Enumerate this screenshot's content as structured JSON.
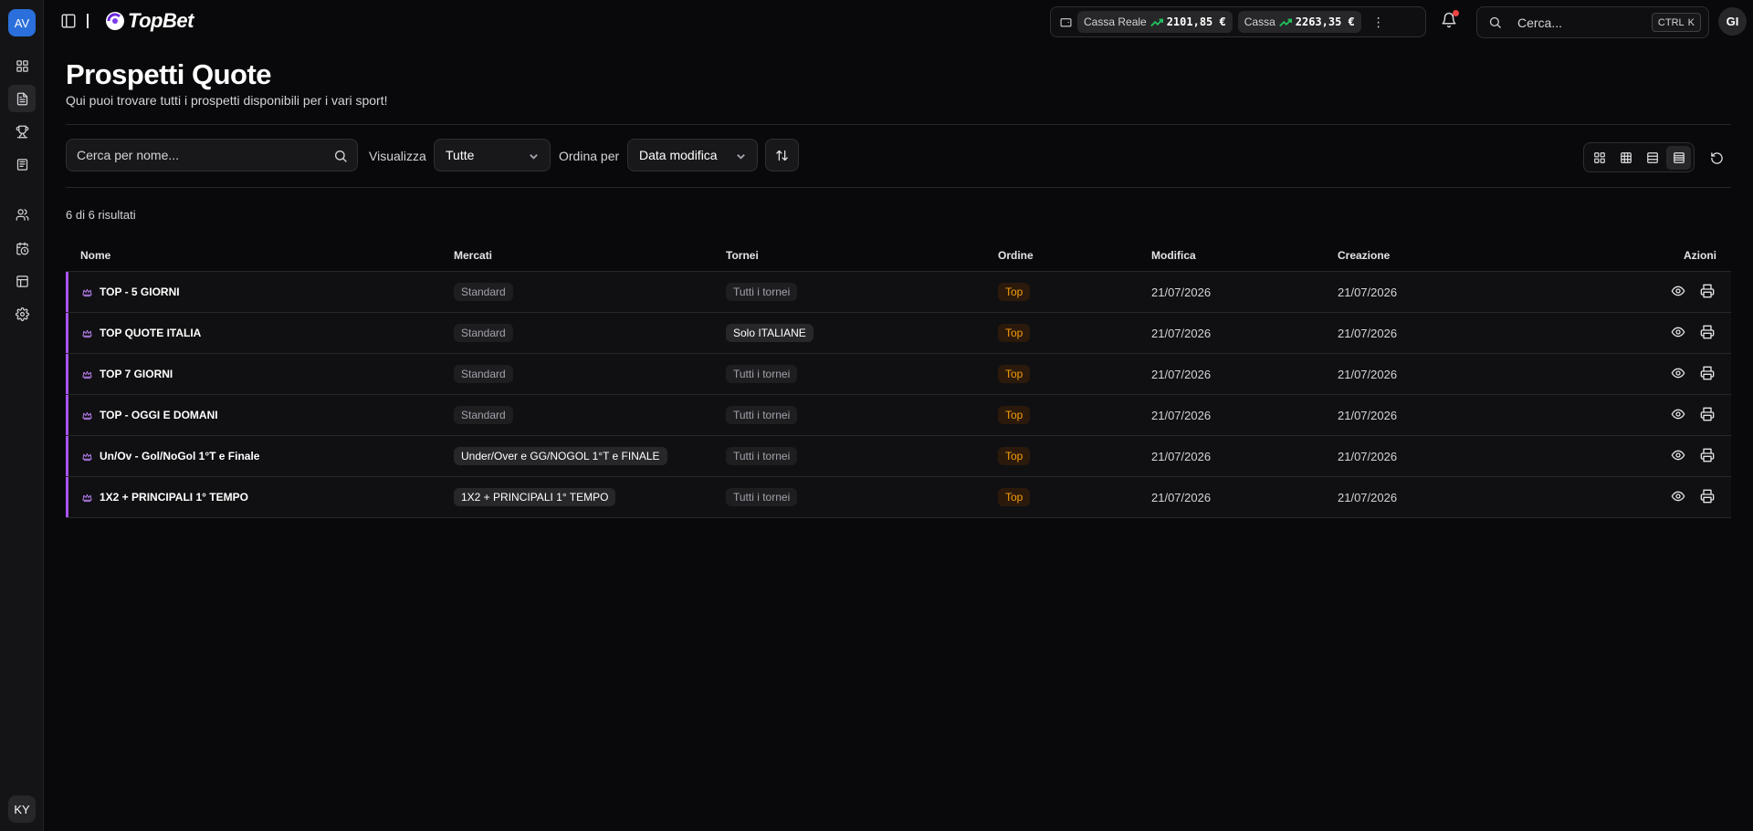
{
  "sidebar": {
    "workspace_initials": "AV",
    "items": [
      {
        "id": "dashboard",
        "icon": "layout-grid-icon"
      },
      {
        "id": "prospetti",
        "icon": "file-text-icon",
        "active": true
      },
      {
        "id": "trophy",
        "icon": "trophy-icon"
      },
      {
        "id": "book",
        "icon": "book-icon"
      },
      {
        "id": "users",
        "icon": "users-icon"
      },
      {
        "id": "calendar",
        "icon": "calendar-clock-icon"
      },
      {
        "id": "table",
        "icon": "table-icon"
      },
      {
        "id": "settings",
        "icon": "gear-icon"
      }
    ],
    "user_initials": "KY"
  },
  "header": {
    "brand": "TopBet",
    "wallet": {
      "cassa_reale_label": "Cassa Reale",
      "cassa_reale_amount": "2101,85 €",
      "cassa_label": "Cassa",
      "cassa_amount": "2263,35 €"
    },
    "search_placeholder": "Cerca...",
    "shortcut_ctrl": "CTRL",
    "shortcut_key": "K",
    "user_initials": "GI",
    "notification_dot_color": "#ef4444"
  },
  "page": {
    "title": "Prospetti Quote",
    "subtitle": "Qui puoi trovare tutti i prospetti disponibili per i vari sport!"
  },
  "filters": {
    "search_placeholder": "Cerca per nome...",
    "view_label": "Visualizza",
    "view_value": "Tutte",
    "sort_label": "Ordina per",
    "sort_value": "Data modifica",
    "active_view": "list"
  },
  "results": {
    "count_text": "6 di 6 risultati"
  },
  "table": {
    "columns": {
      "nome": "Nome",
      "mercati": "Mercati",
      "tornei": "Tornei",
      "ordine": "Ordine",
      "modifica": "Modifica",
      "creazione": "Creazione",
      "azioni": "Azioni"
    },
    "rows": [
      {
        "nome": "TOP - 5 GIORNI",
        "mercati": "Standard",
        "mercati_style": "muted",
        "tornei": "Tutti i tornei",
        "tornei_style": "muted",
        "ordine": "Top",
        "modifica": "21/07/2026",
        "creazione": "21/07/2026"
      },
      {
        "nome": "TOP QUOTE ITALIA",
        "mercati": "Standard",
        "mercati_style": "muted",
        "tornei": "Solo ITALIANE",
        "tornei_style": "bright",
        "ordine": "Top",
        "modifica": "21/07/2026",
        "creazione": "21/07/2026"
      },
      {
        "nome": "TOP 7 GIORNI",
        "mercati": "Standard",
        "mercati_style": "muted",
        "tornei": "Tutti i tornei",
        "tornei_style": "muted",
        "ordine": "Top",
        "modifica": "21/07/2026",
        "creazione": "21/07/2026"
      },
      {
        "nome": "TOP - OGGI E DOMANI",
        "mercati": "Standard",
        "mercati_style": "muted",
        "tornei": "Tutti i tornei",
        "tornei_style": "muted",
        "ordine": "Top",
        "modifica": "21/07/2026",
        "creazione": "21/07/2026"
      },
      {
        "nome": "Un/Ov - Gol/NoGol 1°T e Finale",
        "mercati": "Under/Over e GG/NOGOL 1°T e FINALE",
        "mercati_style": "bright",
        "tornei": "Tutti i tornei",
        "tornei_style": "muted",
        "ordine": "Top",
        "modifica": "21/07/2026",
        "creazione": "21/07/2026"
      },
      {
        "nome": "1X2 + PRINCIPALI 1° TEMPO",
        "mercati": "1X2 + PRINCIPALI 1° TEMPO",
        "mercati_style": "bright",
        "tornei": "Tutti i tornei",
        "tornei_style": "muted",
        "ordine": "Top",
        "modifica": "21/07/2026",
        "creazione": "21/07/2026"
      }
    ]
  },
  "colors": {
    "accent_purple": "#a855f7",
    "order_badge": "#f59e0b",
    "trend_up": "#22c55e",
    "workspace_blue": "#2a6fdb"
  }
}
